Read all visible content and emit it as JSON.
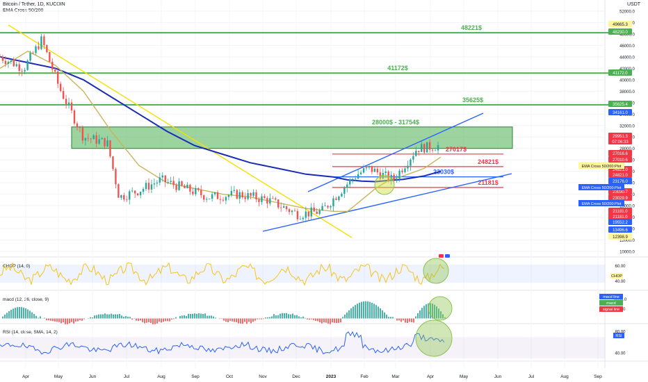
{
  "header": {
    "symbol_line": "Bitcoin / Tether, 1D, KUCOIN",
    "indicator_line": "EMA Cross 50/200",
    "currency": "USDT"
  },
  "chart_data": [
    {
      "type": "candlestick",
      "title": "Bitcoin / Tether, 1D, KUCOIN",
      "x_ticks": [
        "Apr",
        "May",
        "Jun",
        "Jul",
        "Aug",
        "Sep",
        "Oct",
        "Nov",
        "Dec",
        "2023",
        "Feb",
        "Mar",
        "Apr",
        "May",
        "Jun",
        "Jul",
        "Aug",
        "Sep"
      ],
      "y_ticks": [
        52000,
        50000,
        48000,
        46000,
        44000,
        42000,
        40000,
        38000,
        36000,
        34000,
        32000,
        30000,
        28000,
        26000,
        24000,
        22000,
        20000,
        18000,
        16000,
        14000,
        12000,
        10000
      ],
      "y_ticks_labels": [
        "52000.0",
        "50000.0",
        "48000.0",
        "46000.0",
        "44000.0",
        "42000.0",
        "40000.0",
        "38000.0",
        "36000.0",
        "34000.0",
        "32000.0",
        "30000.0",
        "28000.0",
        "26000.0",
        "24000.0",
        "22000.0",
        "20000.0",
        "18000.0",
        "16000.0",
        "14000.0",
        "12000.0",
        "10000.0"
      ],
      "price_series": {
        "x": [
          0,
          0.04,
          0.07,
          0.1,
          0.14,
          0.18,
          0.2,
          0.23,
          0.27,
          0.31,
          0.35,
          0.4,
          0.45,
          0.5,
          0.54,
          0.58,
          0.6,
          0.62,
          0.66,
          0.7,
          0.74
        ],
        "close": [
          44000,
          42000,
          47000,
          38500,
          30000,
          29000,
          19500,
          20500,
          22500,
          21000,
          19500,
          20000,
          19000,
          16500,
          17000,
          21500,
          23500,
          24500,
          22500,
          28000,
          28500
        ]
      },
      "ema50": [
        42000,
        45000,
        42500,
        38000,
        31000,
        25000,
        22000,
        21000,
        20000,
        19500,
        18500,
        17500,
        17000,
        17000,
        19000,
        21000,
        22500,
        23200,
        24500,
        26500
      ],
      "ema200": [
        44000,
        43000,
        42000,
        40000,
        37000,
        34000,
        31000,
        28500,
        27000,
        25500,
        24500,
        23500,
        23000,
        22500,
        22300,
        22200,
        22400,
        22600,
        23200,
        24000
      ],
      "horizontal_levels": [
        {
          "label": "48221$",
          "value": 48221,
          "color": "#4caf50"
        },
        {
          "label": "41172$",
          "value": 41172,
          "color": "#4caf50"
        },
        {
          "label": "35625$",
          "value": 35625,
          "color": "#4caf50"
        },
        {
          "label": "27017$",
          "value": 27017,
          "color": "#f23645"
        },
        {
          "label": "24821$",
          "value": 24821,
          "color": "#f23645"
        },
        {
          "label": "23030$",
          "value": 23030,
          "color": "#2962ff"
        },
        {
          "label": "21181$",
          "value": 21181,
          "color": "#f23645"
        }
      ],
      "zone": {
        "label": "28000$ - 31754$",
        "low": 28000,
        "high": 31754
      },
      "price_tags": [
        {
          "text": "49665.3",
          "bg": "#fff59d",
          "fg": "#131722"
        },
        {
          "text": "48230.0",
          "bg": "#4caf50",
          "fg": "#ffffff"
        },
        {
          "text": "41172.0",
          "bg": "#4caf50",
          "fg": "#ffffff"
        },
        {
          "text": "35625.4",
          "bg": "#4caf50",
          "fg": "#ffffff"
        },
        {
          "text": "34161.0",
          "bg": "#2962ff",
          "fg": "#ffffff"
        },
        {
          "text": "29951.3",
          "bg": "#f23645",
          "fg": "#ffffff"
        },
        {
          "text": "07:06:33",
          "bg": "#f23645",
          "fg": "#ffffff"
        },
        {
          "text": "27016.6",
          "bg": "#f23645",
          "fg": "#ffffff"
        },
        {
          "text": "27010.6",
          "bg": "#f23645",
          "fg": "#ffffff"
        },
        {
          "text": "24821.0",
          "bg": "#f23645",
          "fg": "#ffffff"
        },
        {
          "text": "24821.0",
          "bg": "#f23645",
          "fg": "#ffffff"
        },
        {
          "text": "23176.0",
          "bg": "#2962ff",
          "fg": "#ffffff"
        },
        {
          "text": "23030.7",
          "bg": "#f23645",
          "fg": "#ffffff"
        },
        {
          "text": "23029.9",
          "bg": "#f23645",
          "fg": "#ffffff"
        },
        {
          "text": "21181.0",
          "bg": "#f23645",
          "fg": "#ffffff"
        },
        {
          "text": "21181.0",
          "bg": "#f23645",
          "fg": "#ffffff"
        },
        {
          "text": "19552.2",
          "bg": "#2962ff",
          "fg": "#ffffff"
        },
        {
          "text": "13496.6",
          "bg": "#2962ff",
          "fg": "#ffffff"
        },
        {
          "text": "12398.9",
          "bg": "#fff59d",
          "fg": "#131722"
        }
      ],
      "side_labels": [
        {
          "text": "EMA Cross 50/200:Plot",
          "bg": "#fff59d",
          "fg": "#131722"
        },
        {
          "text": "EMA Cross 50/200:Plot",
          "bg": "#2962ff",
          "fg": "#ffffff"
        },
        {
          "text": "EMA Cross 50/200:Plot",
          "bg": "#2962ff",
          "fg": "#ffffff"
        }
      ]
    },
    {
      "type": "line",
      "title": "CHOP (14, 0)",
      "y_ticks": [
        60.0,
        40.0
      ],
      "y_ticks_labels": [
        "60.00",
        "40.00"
      ],
      "legend": [
        {
          "text": "CHOP",
          "bg": "#fff59d",
          "fg": "#131722"
        }
      ],
      "series": [
        {
          "name": "CHOP",
          "color": "#f5c518"
        }
      ]
    },
    {
      "type": "bar",
      "title": "macd (12, 26, close, 9)",
      "y_ticks": [
        1000.0,
        500.0
      ],
      "y_ticks_labels": [
        "1000.0",
        "500.0"
      ],
      "legend": [
        {
          "text": "macd line",
          "bg": "#2962ff",
          "fg": "#ffffff"
        },
        {
          "text": "macd",
          "bg": "#4caf50",
          "fg": "#ffffff"
        },
        {
          "text": "signal line",
          "bg": "#f23645",
          "fg": "#ffffff"
        }
      ]
    },
    {
      "type": "line",
      "title": "RSI (14, close, SMA, 14, 2)",
      "y_ticks": [
        80.0,
        40.0
      ],
      "y_ticks_labels": [
        "80.00",
        "40.00"
      ],
      "legend": [
        {
          "text": "RSI",
          "bg": "#2962ff",
          "fg": "#ffffff"
        }
      ],
      "series": [
        {
          "name": "RSI",
          "color": "#2962ff"
        }
      ]
    }
  ]
}
